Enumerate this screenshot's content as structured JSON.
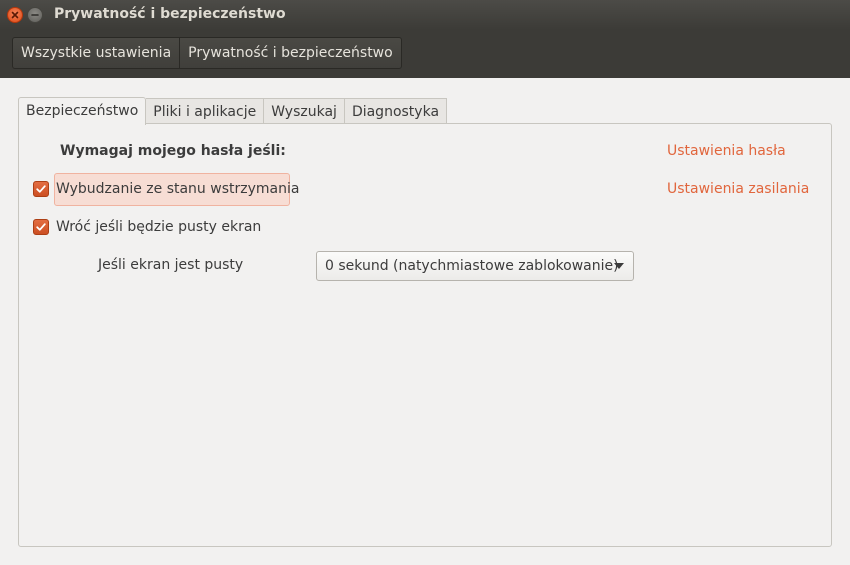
{
  "window": {
    "title": "Prywatność i bezpieczeństwo",
    "buttons": [
      "close-icon",
      "minimize-icon"
    ]
  },
  "breadcrumbs": {
    "all_settings": "Wszystkie ustawienia",
    "current": "Prywatność i bezpieczeństwo"
  },
  "tabs": [
    {
      "label": "Bezpieczeństwo",
      "active": true
    },
    {
      "label": "Pliki i aplikacje",
      "active": false
    },
    {
      "label": "Wyszukaj",
      "active": false
    },
    {
      "label": "Diagnostyka",
      "active": false
    }
  ],
  "security": {
    "heading": "Wymagaj mojego hasła jeśli:",
    "password_settings_link": "Ustawienia hasła",
    "power_settings_link": "Ustawienia zasilania",
    "wake_from_suspend": {
      "label": "Wybudzanie ze stanu wstrzymania",
      "checked": true
    },
    "return_from_blank": {
      "label": "Wróć jeśli będzie pusty ekran",
      "checked": true
    },
    "blank_delay": {
      "label": "Jeśli ekran jest pusty",
      "selected": "0 sekund (natychmiastowe zablokowanie)"
    }
  },
  "colors": {
    "accent": "#dd4814",
    "link": "#e1663d",
    "titlebar": "#3c3b37",
    "background": "#f2f1f0"
  }
}
